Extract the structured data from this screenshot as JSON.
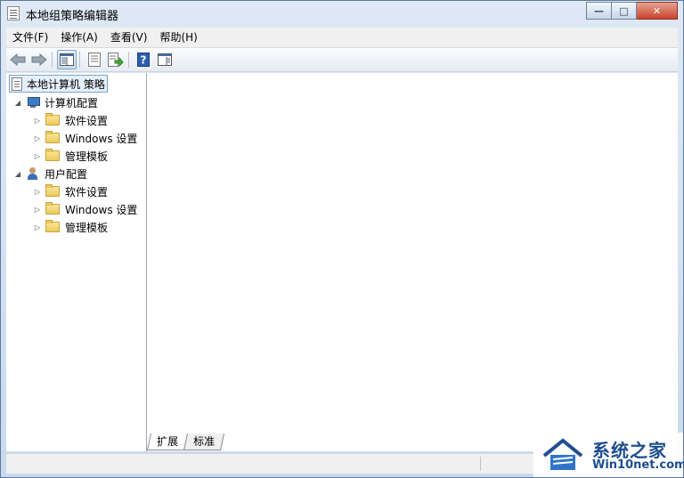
{
  "window": {
    "title": "本地组策略编辑器",
    "controls": {
      "minimize": "—",
      "maximize": "□",
      "close": "✕"
    }
  },
  "menubar": {
    "items": [
      "文件(F)",
      "操作(A)",
      "查看(V)",
      "帮助(H)"
    ]
  },
  "toolbar": {
    "buttons": [
      "back-icon",
      "forward-icon",
      "show-hide-tree-icon",
      "properties-icon",
      "export-list-icon",
      "help-icon",
      "show-hide-action-pane-icon"
    ]
  },
  "tree": {
    "root": "本地计算机 策略",
    "computer_config": {
      "label": "计算机配置",
      "children": [
        "软件设置",
        "Windows 设置",
        "管理模板"
      ]
    },
    "user_config": {
      "label": "用户配置",
      "children": [
        "软件设置",
        "Windows 设置",
        "管理模板"
      ]
    }
  },
  "tabs": [
    "扩展",
    "标准"
  ],
  "watermark": {
    "brand": "系统之家",
    "site": "Win10net.com"
  },
  "colors": {
    "accent": "#3d7cc9",
    "watermark": "#1e4e8f"
  }
}
